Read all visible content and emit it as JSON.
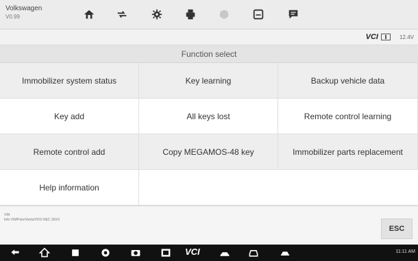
{
  "app": {
    "title": "Volkswagen",
    "version": "V0.99"
  },
  "toolbar": {
    "buttons": [
      {
        "name": "home-icon"
      },
      {
        "name": "vehicle-swap-icon"
      },
      {
        "name": "settings-gear-icon"
      },
      {
        "name": "printer-icon"
      },
      {
        "name": "help-icon"
      },
      {
        "name": "save-icon"
      },
      {
        "name": "message-icon"
      }
    ]
  },
  "status": {
    "vci_label": "VCI",
    "voltage": "12.4V"
  },
  "function_select": {
    "title": "Function select",
    "items": [
      "Immobilizer system status",
      "Key learning",
      "Backup vehicle data",
      "Key add",
      "All keys lost",
      "Remote control learning",
      "Remote control add",
      "Copy MEGAMOS-48 key",
      "Immobilizer parts replacement",
      "Help information"
    ]
  },
  "info": {
    "vin_label": "VIN",
    "path": "Info:VW/Polo/Vento/VDO NEC 35XX"
  },
  "esc_label": "ESC",
  "system_bar": {
    "vci_text": "VCI",
    "clock": "11:11 AM"
  },
  "colors": {
    "toolbar_bg": "#ececec",
    "shade_cell": "#eeeeee",
    "nav_bg": "#111111",
    "icon_dark": "#333333"
  }
}
